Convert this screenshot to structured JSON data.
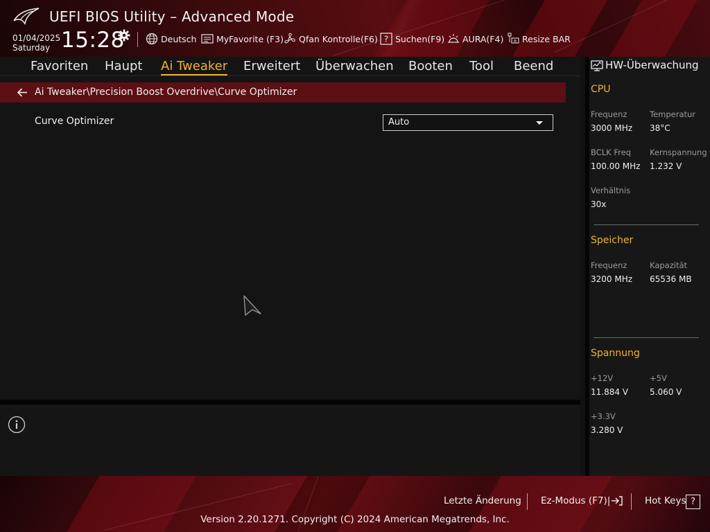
{
  "header": {
    "title": "UEFI BIOS Utility – Advanced Mode",
    "date": "01/04/2025",
    "day": "Saturday",
    "time": "15:28",
    "toolbar": [
      {
        "label": "Deutsch",
        "icon": "globe-icon"
      },
      {
        "label": "MyFavorite (F3)",
        "icon": "favorite-list-icon"
      },
      {
        "label": "Qfan Kontrolle(F6)",
        "icon": "fan-icon"
      },
      {
        "label": "Suchen(F9)",
        "icon": "search-help-icon"
      },
      {
        "label": "AURA(F4)",
        "icon": "aura-light-icon"
      },
      {
        "label": "Resize BAR",
        "icon": "resize-bar-icon"
      }
    ]
  },
  "menu": {
    "tabs": [
      "Favoriten",
      "Haupt",
      "Ai Tweaker",
      "Erweitert",
      "Überwachen",
      "Booten",
      "Tool",
      "Beend"
    ],
    "active": "Ai Tweaker"
  },
  "breadcrumb": "Ai Tweaker\\Precision Boost Overdrive\\Curve Optimizer",
  "settings": {
    "curve_optimizer_label": "Curve Optimizer",
    "curve_optimizer_value": "Auto"
  },
  "hw_monitor": {
    "title": "HW-Überwachung",
    "cpu": {
      "title": "CPU",
      "freq_label": "Frequenz",
      "freq_value": "3000 MHz",
      "temp_label": "Temperatur",
      "temp_value": "38°C",
      "bclk_label": "BCLK Freq",
      "bclk_value": "100.00 MHz",
      "vcore_label": "Kernspannung",
      "vcore_value": "1.232 V",
      "ratio_label": "Verhältnis",
      "ratio_value": "30x"
    },
    "memory": {
      "title": "Speicher",
      "freq_label": "Frequenz",
      "freq_value": "3200 MHz",
      "cap_label": "Kapazität",
      "cap_value": "65536 MB"
    },
    "voltage": {
      "title": "Spannung",
      "v12_label": "+12V",
      "v12_value": "11.884 V",
      "v5_label": "+5V",
      "v5_value": "5.060 V",
      "v33_label": "+3.3V",
      "v33_value": "3.280 V"
    }
  },
  "footer": {
    "last_change": "Letzte Änderung",
    "ez_mode": "Ez-Modus (F7)|",
    "hot_keys": "Hot Keys",
    "hot_keys_box": "?",
    "version": "Version 2.20.1271. Copyright (C) 2024 American Megatrends, Inc."
  },
  "colors": {
    "accent": "#f3b132",
    "breadcrumb_bg": "#5c0f14",
    "header_red": "#5a0d12"
  }
}
